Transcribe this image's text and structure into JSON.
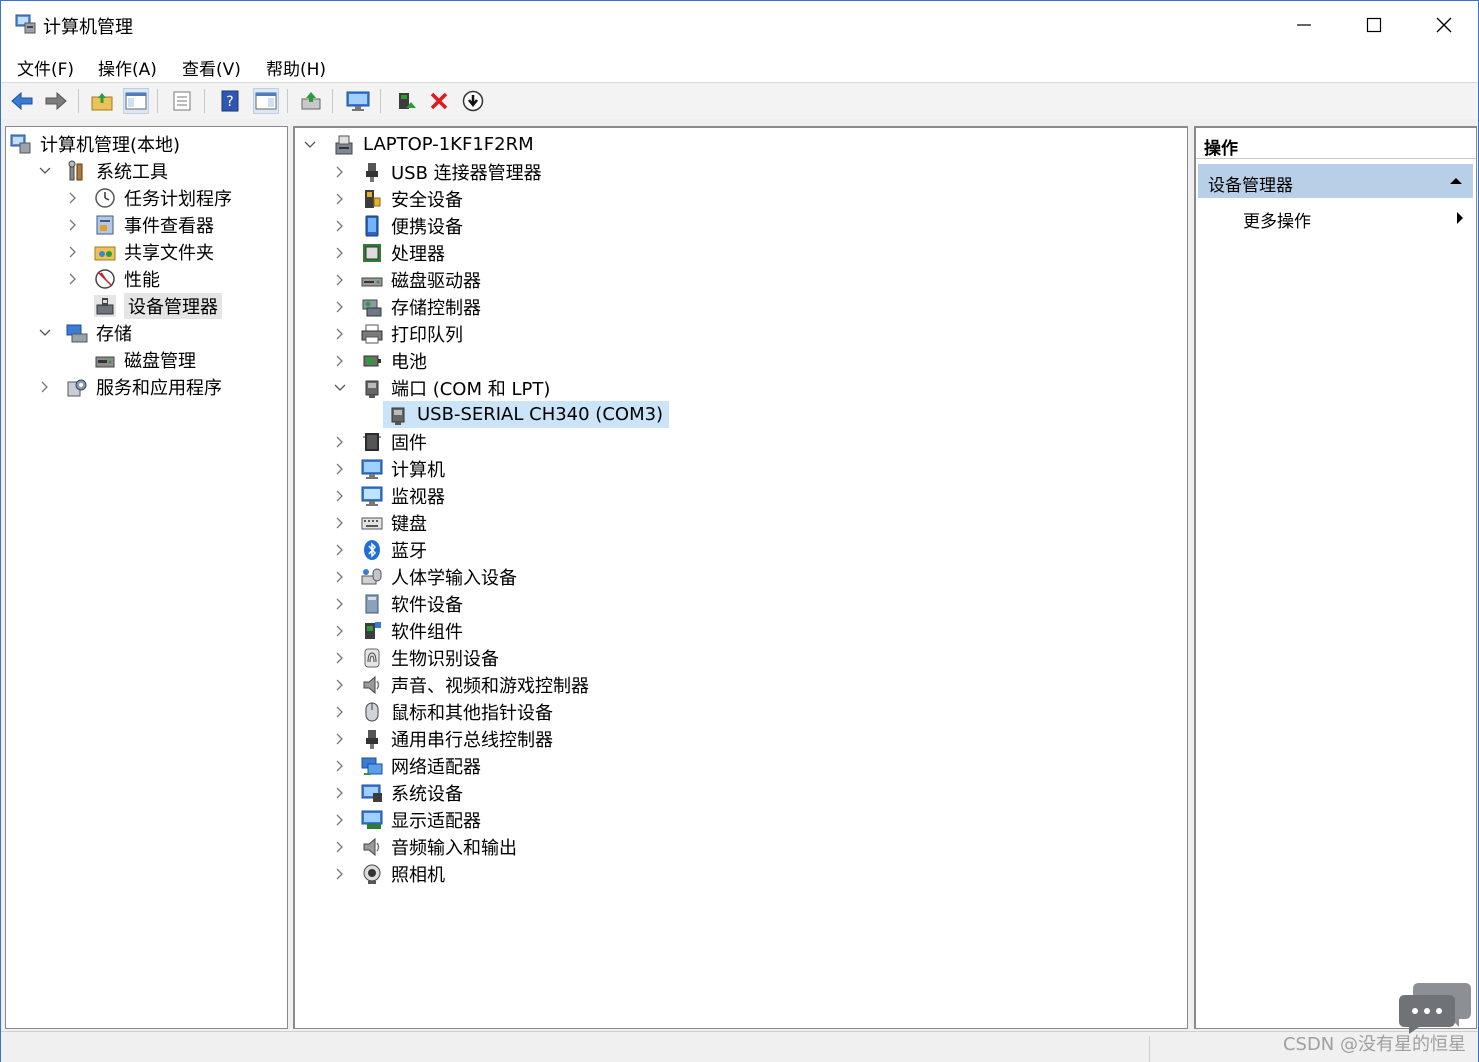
{
  "window": {
    "title": "计算机管理"
  },
  "menu": [
    "文件(F)",
    "操作(A)",
    "查看(V)",
    "帮助(H)"
  ],
  "left_tree": [
    {
      "label": "计算机管理(本地)",
      "icon": "computer-management-icon",
      "level": 0,
      "chevron": ""
    },
    {
      "label": "系统工具",
      "icon": "system-tools-icon",
      "level": 1,
      "chevron": "expanded"
    },
    {
      "label": "任务计划程序",
      "icon": "clock-icon",
      "level": 2,
      "chevron": "collapsed"
    },
    {
      "label": "事件查看器",
      "icon": "event-viewer-icon",
      "level": 2,
      "chevron": "collapsed"
    },
    {
      "label": "共享文件夹",
      "icon": "shared-folder-icon",
      "level": 2,
      "chevron": "collapsed"
    },
    {
      "label": "性能",
      "icon": "performance-icon",
      "level": 2,
      "chevron": "collapsed"
    },
    {
      "label": "设备管理器",
      "icon": "device-manager-icon",
      "level": 2,
      "chevron": "",
      "selected": true
    },
    {
      "label": "存储",
      "icon": "storage-icon",
      "level": 1,
      "chevron": "expanded"
    },
    {
      "label": "磁盘管理",
      "icon": "disk-management-icon",
      "level": 2,
      "chevron": ""
    },
    {
      "label": "服务和应用程序",
      "icon": "services-icon",
      "level": 1,
      "chevron": "collapsed"
    }
  ],
  "device_tree": {
    "root": "LAPTOP-1KF1F2RM",
    "items": [
      {
        "label": "USB 连接器管理器",
        "icon": "usb-connector-icon",
        "chevron": "collapsed"
      },
      {
        "label": "安全设备",
        "icon": "security-device-icon",
        "chevron": "collapsed"
      },
      {
        "label": "便携设备",
        "icon": "portable-device-icon",
        "chevron": "collapsed"
      },
      {
        "label": "处理器",
        "icon": "processor-icon",
        "chevron": "collapsed"
      },
      {
        "label": "磁盘驱动器",
        "icon": "disk-drive-icon",
        "chevron": "collapsed"
      },
      {
        "label": "存储控制器",
        "icon": "storage-controller-icon",
        "chevron": "collapsed"
      },
      {
        "label": "打印队列",
        "icon": "printer-icon",
        "chevron": "collapsed"
      },
      {
        "label": "电池",
        "icon": "battery-icon",
        "chevron": "collapsed"
      },
      {
        "label": "端口 (COM 和 LPT)",
        "icon": "port-icon",
        "chevron": "expanded"
      },
      {
        "label": "USB-SERIAL CH340 (COM3)",
        "icon": "serial-port-icon",
        "chevron": "",
        "child": true,
        "selected": true
      },
      {
        "label": "固件",
        "icon": "firmware-icon",
        "chevron": "collapsed"
      },
      {
        "label": "计算机",
        "icon": "computer-icon",
        "chevron": "collapsed"
      },
      {
        "label": "监视器",
        "icon": "monitor-icon",
        "chevron": "collapsed"
      },
      {
        "label": "键盘",
        "icon": "keyboard-icon",
        "chevron": "collapsed"
      },
      {
        "label": "蓝牙",
        "icon": "bluetooth-icon",
        "chevron": "collapsed"
      },
      {
        "label": "人体学输入设备",
        "icon": "hid-icon",
        "chevron": "collapsed"
      },
      {
        "label": "软件设备",
        "icon": "software-device-icon",
        "chevron": "collapsed"
      },
      {
        "label": "软件组件",
        "icon": "software-component-icon",
        "chevron": "collapsed"
      },
      {
        "label": "生物识别设备",
        "icon": "biometric-icon",
        "chevron": "collapsed"
      },
      {
        "label": "声音、视频和游戏控制器",
        "icon": "sound-icon",
        "chevron": "collapsed"
      },
      {
        "label": "鼠标和其他指针设备",
        "icon": "mouse-icon",
        "chevron": "collapsed"
      },
      {
        "label": "通用串行总线控制器",
        "icon": "usb-controller-icon",
        "chevron": "collapsed"
      },
      {
        "label": "网络适配器",
        "icon": "network-adapter-icon",
        "chevron": "collapsed"
      },
      {
        "label": "系统设备",
        "icon": "system-device-icon",
        "chevron": "collapsed"
      },
      {
        "label": "显示适配器",
        "icon": "display-adapter-icon",
        "chevron": "collapsed"
      },
      {
        "label": "音频输入和输出",
        "icon": "audio-io-icon",
        "chevron": "collapsed"
      },
      {
        "label": "照相机",
        "icon": "camera-icon",
        "chevron": "collapsed"
      }
    ]
  },
  "actions": {
    "header": "操作",
    "section": "设备管理器",
    "more": "更多操作"
  },
  "watermark": "CSDN @没有星的恒星",
  "colors": {
    "selection": "#cce4f7",
    "action_section": "#b8cfe8",
    "window_border": "#3b6fd8"
  }
}
